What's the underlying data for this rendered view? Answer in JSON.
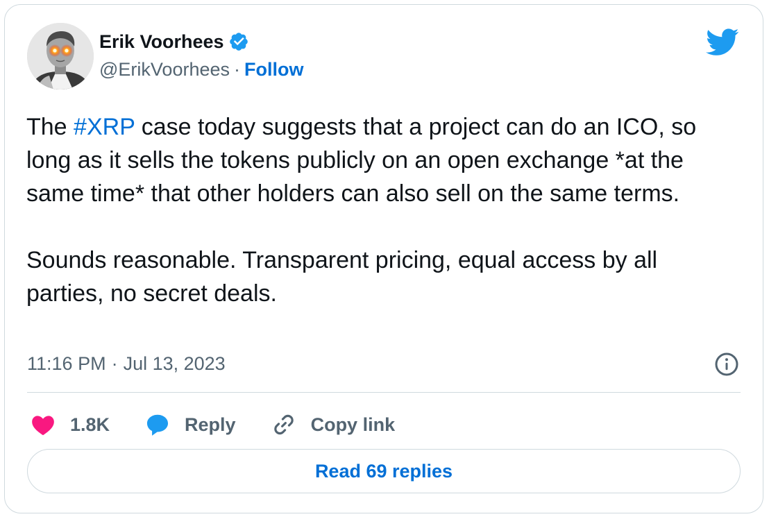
{
  "author": {
    "display_name": "Erik Voorhees",
    "handle": "@ErikVoorhees",
    "separator": "·",
    "follow_label": "Follow",
    "verified": true
  },
  "tweet": {
    "pre_hashtag": "The ",
    "hashtag": "#XRP",
    "post_hashtag": " case today suggests that a project can do an ICO, so long as it sells the tokens publicly on an open exchange *at the same time* that other holders can also sell on the same terms.",
    "paragraph2": "Sounds reasonable. Transparent pricing, equal access by all parties, no secret deals."
  },
  "meta": {
    "time": "11:16 PM",
    "separator": "·",
    "date": "Jul 13, 2023"
  },
  "actions": {
    "like_count": "1.8K",
    "reply_label": "Reply",
    "copy_label": "Copy link"
  },
  "read_replies_label": "Read 69 replies",
  "colors": {
    "link_blue": "#006fd6",
    "twitter_blue": "#1d9bf0",
    "heart_pink": "#f91880",
    "text_dark": "#0f1419",
    "text_gray": "#536471",
    "border": "#cfd9de"
  },
  "icons": {
    "brand": "twitter-bird-icon",
    "verified": "verified-badge-icon",
    "info": "info-icon",
    "like": "heart-icon",
    "reply": "speech-bubble-icon",
    "copy": "link-icon"
  }
}
